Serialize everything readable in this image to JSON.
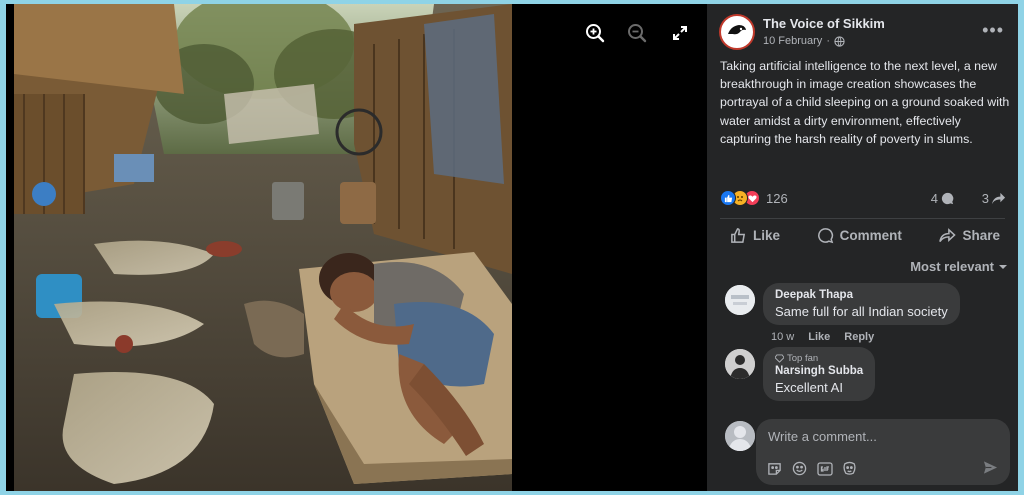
{
  "viewer": {
    "icons": [
      "zoom-in-icon",
      "zoom-out-icon",
      "fullscreen-icon"
    ]
  },
  "post": {
    "page_name": "The Voice of Sikkim",
    "date": "10 February",
    "separator": "·",
    "privacy_icon": "globe-icon",
    "more": "•••",
    "text": "Taking artificial intelligence to the next level, a new breakthrough in image creation showcases the portrayal of a child sleeping on a ground soaked with water amidst a dirty environment, effectively capturing the harsh reality of poverty in slums.",
    "reaction_count": "126",
    "comment_count": "4",
    "share_count": "3",
    "reaction_colors": {
      "like": "#1877f2",
      "sad": "#f7b125",
      "love": "#f33e58"
    }
  },
  "actions": {
    "like": "Like",
    "comment": "Comment",
    "share": "Share"
  },
  "sort_label": "Most relevant",
  "comments": [
    {
      "name": "Deepak Thapa",
      "text": "Same full for all Indian society",
      "time": "10 w",
      "like": "Like",
      "reply": "Reply"
    },
    {
      "badge": "Top fan",
      "name": "Narsingh Subba",
      "text": "Excellent AI"
    }
  ],
  "composer": {
    "placeholder": "Write a comment...",
    "icons": [
      "sticker-icon",
      "emoji-icon",
      "gif-icon",
      "avatar-sticker-icon",
      "send-icon"
    ]
  }
}
